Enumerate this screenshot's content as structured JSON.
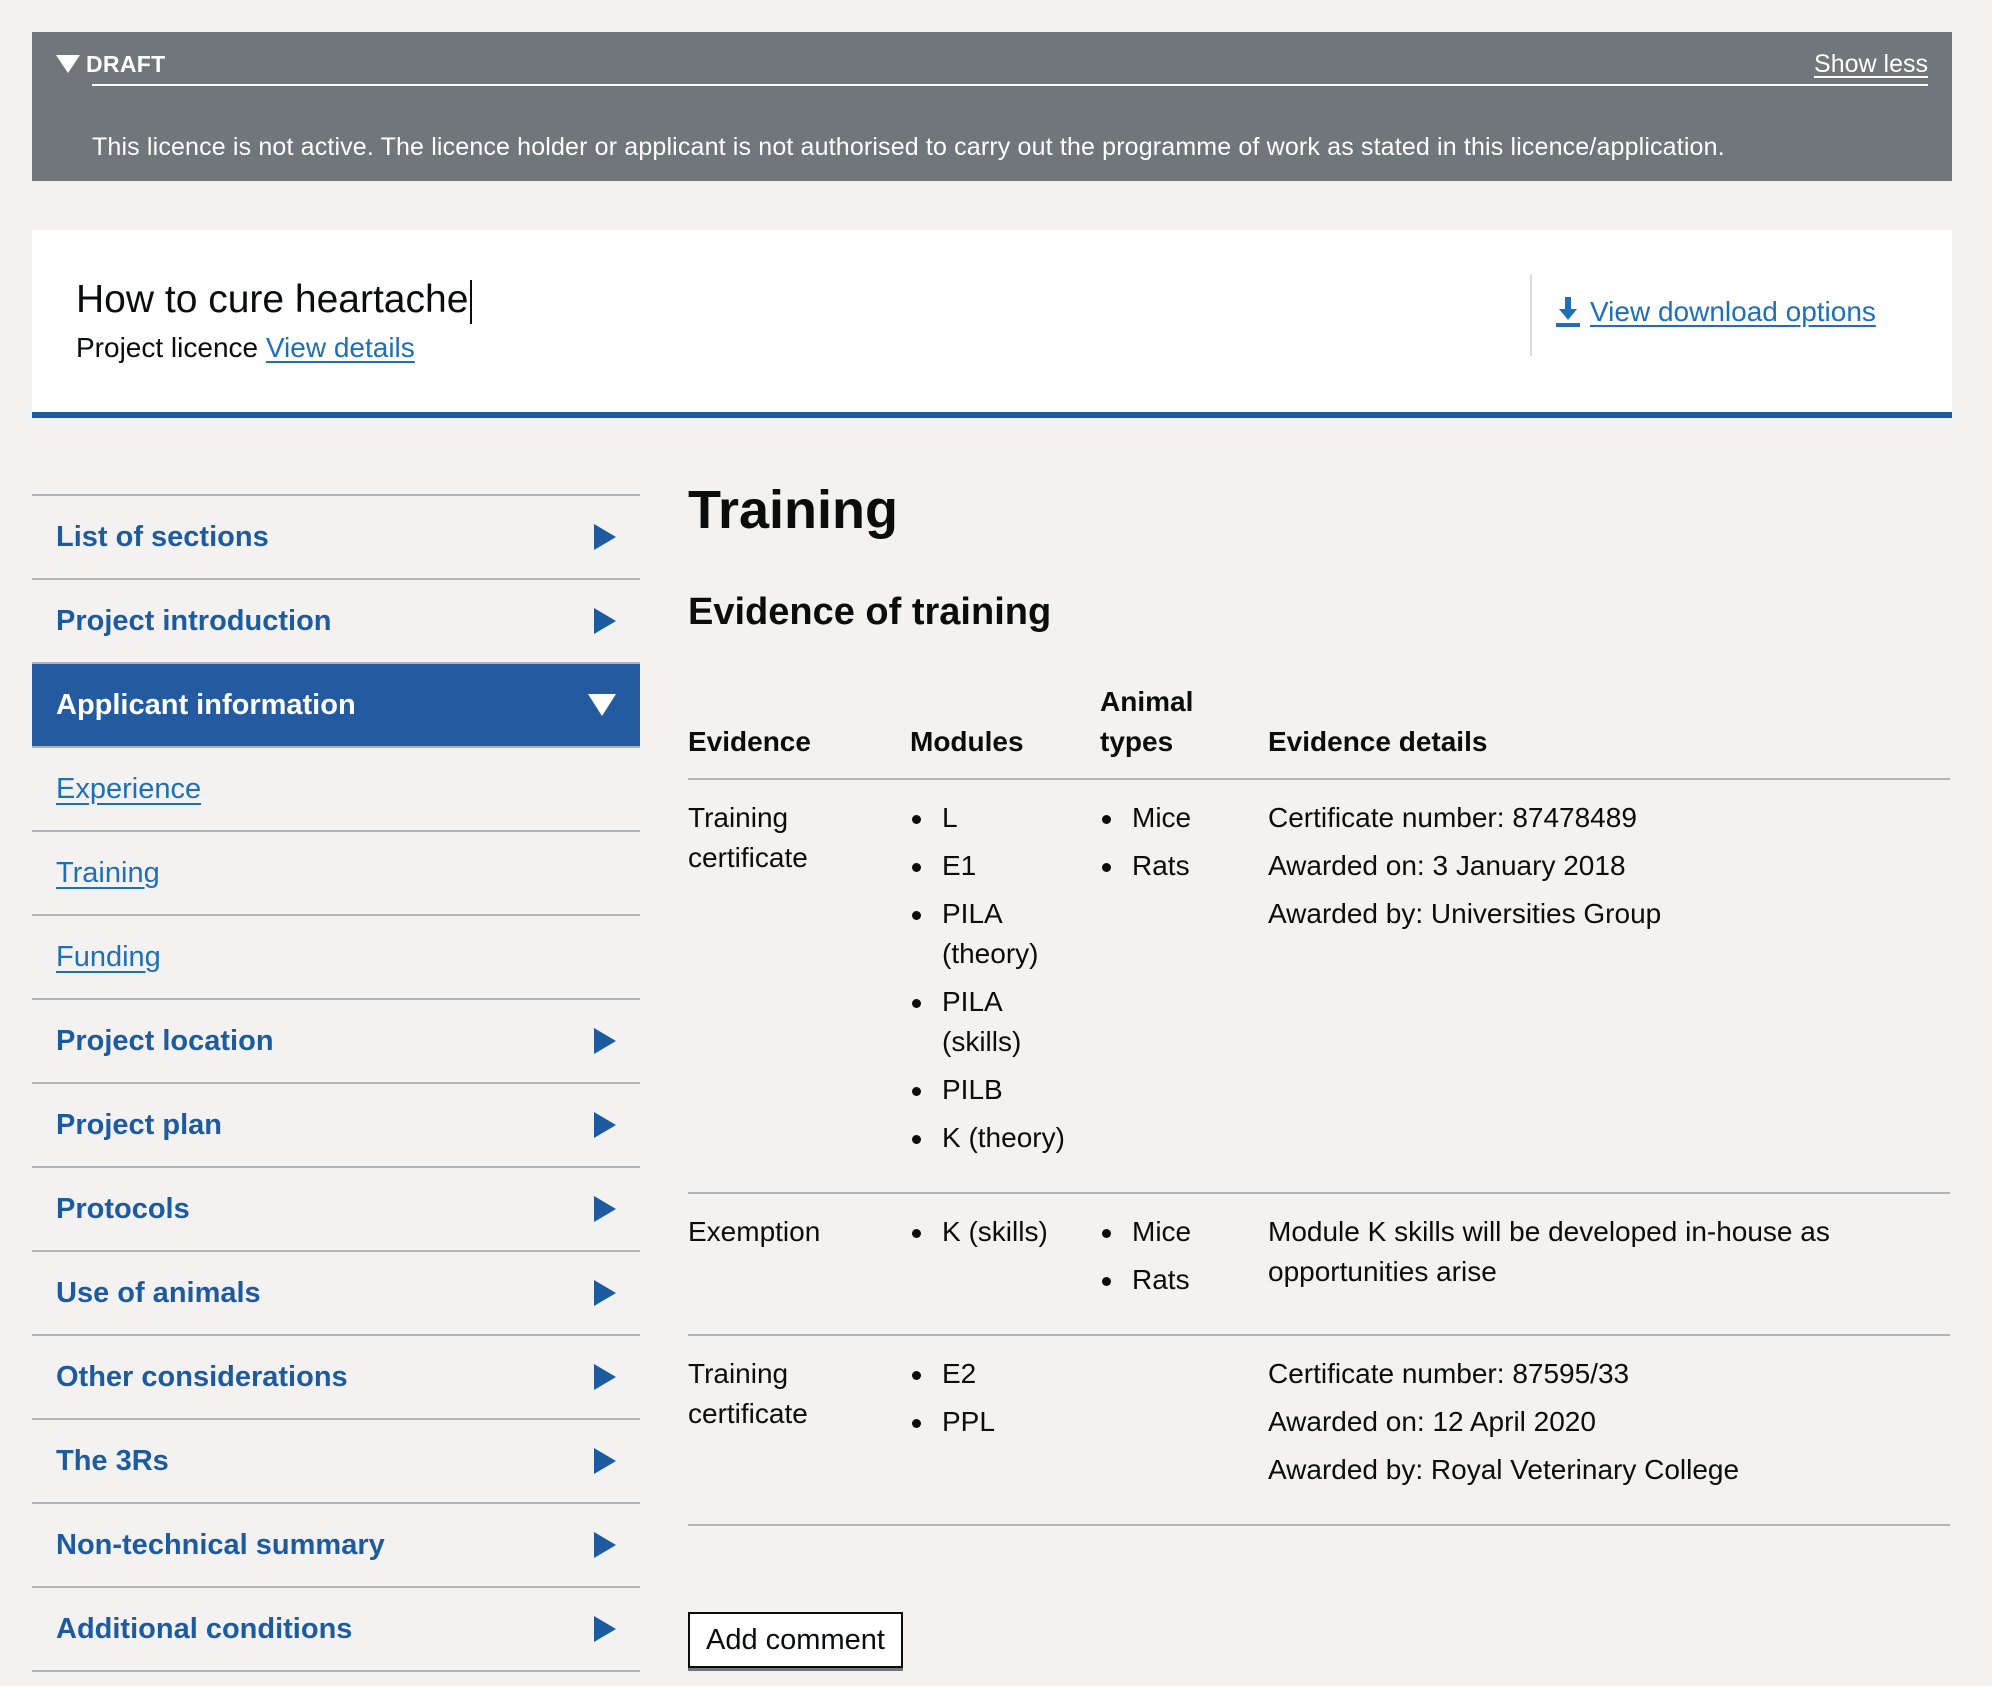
{
  "banner": {
    "label": "DRAFT",
    "toggle": "Show less",
    "message": "This licence is not active. The licence holder or applicant is not authorised to carry out the programme of work as stated in this licence/application."
  },
  "project": {
    "title": "How to cure heartache",
    "type": "Project licence",
    "details_link": "View details",
    "download_link": "View download options"
  },
  "sidebar": {
    "items": [
      {
        "label": "List of sections"
      },
      {
        "label": "Project introduction"
      },
      {
        "label": "Applicant information"
      },
      {
        "label": "Project location"
      },
      {
        "label": "Project plan"
      },
      {
        "label": "Protocols"
      },
      {
        "label": "Use of animals"
      },
      {
        "label": "Other considerations"
      },
      {
        "label": "The 3Rs"
      },
      {
        "label": "Non-technical summary"
      },
      {
        "label": "Additional conditions"
      }
    ],
    "subitems": [
      {
        "label": "Experience"
      },
      {
        "label": "Training"
      },
      {
        "label": "Funding"
      }
    ]
  },
  "main": {
    "title": "Training",
    "subtitle": "Evidence of training",
    "table": {
      "headers": [
        "Evidence",
        "Modules",
        "Animal types",
        "Evidence details"
      ],
      "rows": [
        {
          "evidence": "Training certificate",
          "modules": [
            "L",
            "E1",
            "PILA (theory)",
            "PILA (skills)",
            "PILB",
            "K (theory)"
          ],
          "animals": [
            "Mice",
            "Rats"
          ],
          "details": [
            "Certificate number: 87478489",
            "Awarded on: 3 January 2018",
            "Awarded by: Universities Group"
          ]
        },
        {
          "evidence": "Exemption",
          "modules": [
            "K (skills)"
          ],
          "animals": [
            "Mice",
            "Rats"
          ],
          "details": [
            "Module K skills will be developed in-house as opportunities arise"
          ]
        },
        {
          "evidence": "Training certificate",
          "modules": [
            "E2",
            "PPL"
          ],
          "animals": [],
          "details": [
            "Certificate number: 87595/33",
            "Awarded on: 12 April 2020",
            "Awarded by: Royal Veterinary College"
          ]
        }
      ]
    },
    "add_comment": "Add comment"
  }
}
